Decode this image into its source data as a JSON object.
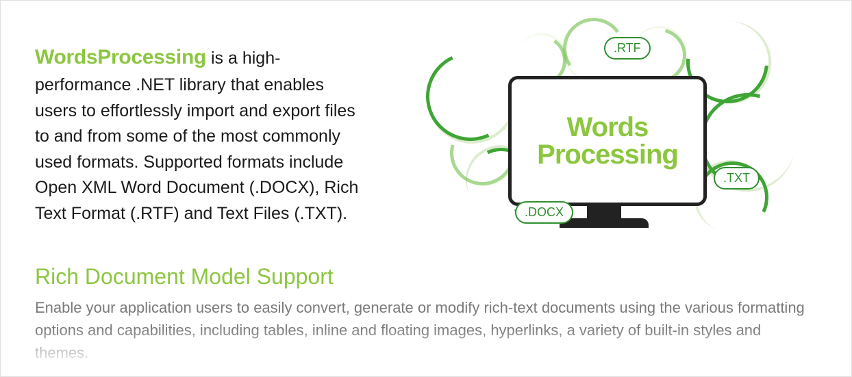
{
  "intro": {
    "brand": "WordsProcessing",
    "body": " is a high-performance .NET library that enables users to effortlessly import and export files to and from some of the most commonly used formats. Supported formats include Open XML Word Document (.DOCX), Rich Text Format (.RTF) and Text Files (.TXT)."
  },
  "illustration": {
    "monitor_line1": "Words",
    "monitor_line2": "Processing",
    "formats": {
      "rtf": ".RTF",
      "txt": ".TXT",
      "docx": ".DOCX"
    }
  },
  "section": {
    "title": "Rich Document Model Support",
    "body": "Enable your application users to easily convert, generate or modify rich-text documents using the various formatting options and capabilities, including tables, inline and floating images, hyperlinks, a variety of built-in styles and themes."
  },
  "colors": {
    "accent": "#8cc63f",
    "arrow": "#3fa535",
    "body_text": "#1a1a1a",
    "muted_text": "#7a7a7a"
  }
}
